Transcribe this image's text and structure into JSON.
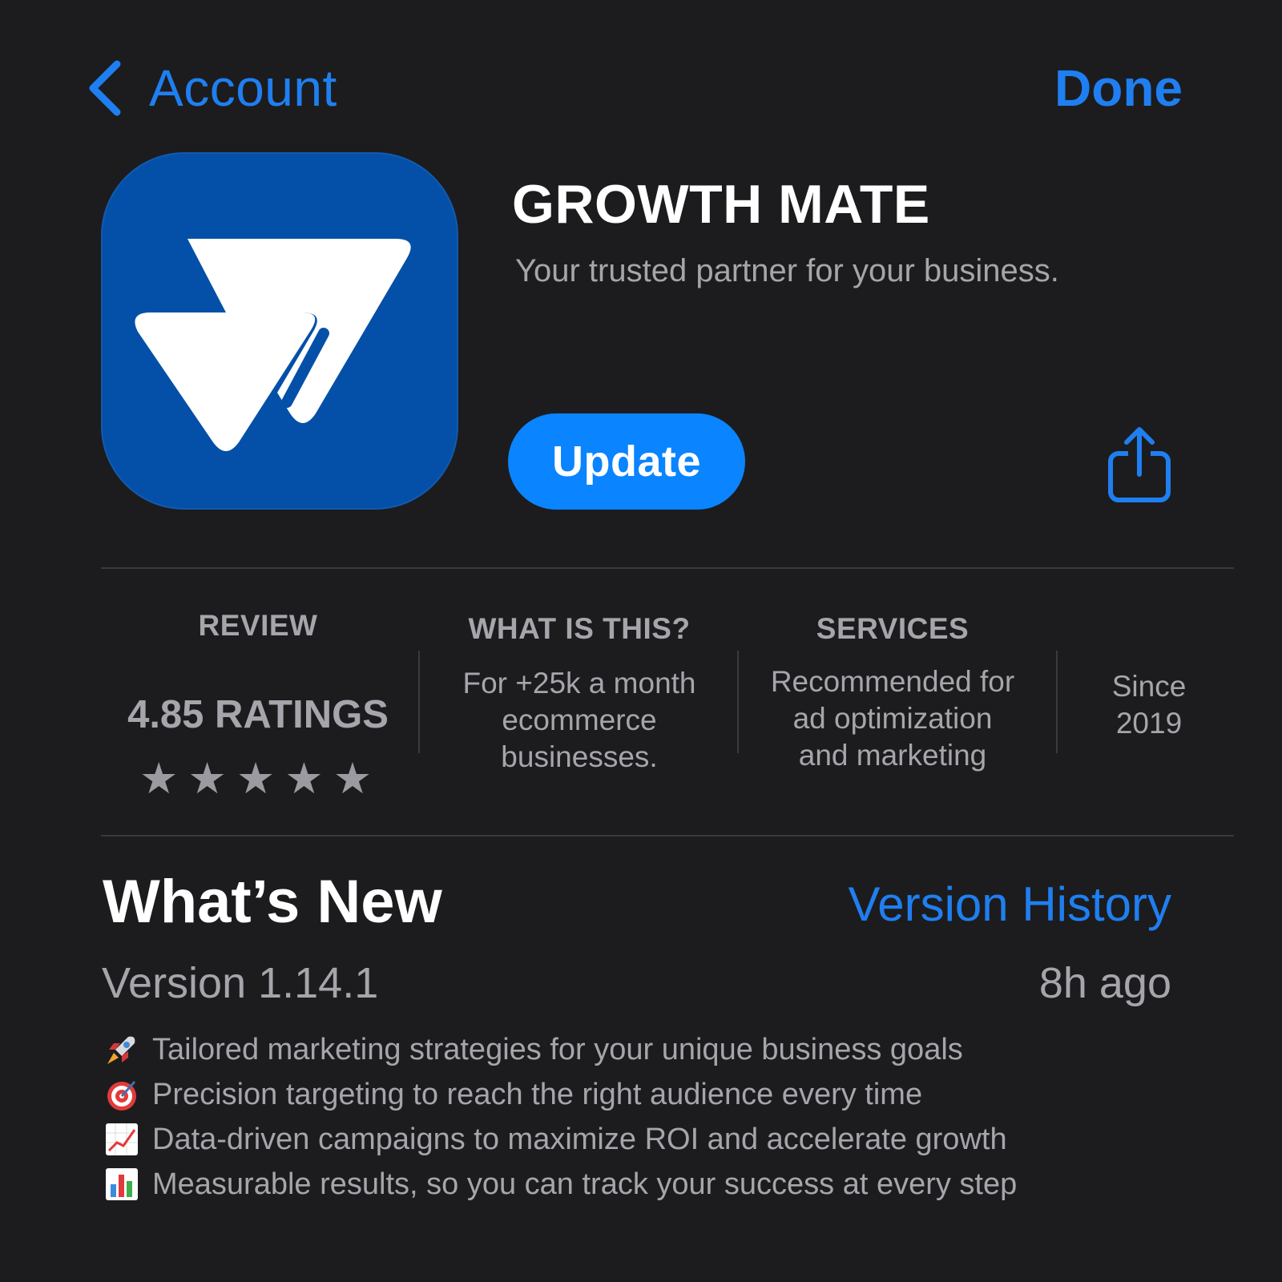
{
  "nav": {
    "back_label": "Account",
    "done_label": "Done"
  },
  "app": {
    "title": "GROWTH MATE",
    "subtitle": "Your trusted partner for your business.",
    "update_label": "Update"
  },
  "info": {
    "review": {
      "heading": "REVIEW",
      "value": "4.85 RATINGS",
      "stars": 5
    },
    "about": {
      "heading": "WHAT IS THIS?",
      "lines": [
        "For +25k a month",
        "ecommerce",
        "businesses."
      ]
    },
    "services": {
      "heading": "SERVICES",
      "lines": [
        "Recommended for",
        "ad optimization",
        "and marketing"
      ]
    },
    "since": {
      "lines": [
        "Since",
        "2019"
      ]
    }
  },
  "whats_new": {
    "title": "What’s New",
    "version_history_label": "Version History",
    "version": "Version 1.14.1",
    "time": "8h ago",
    "notes": [
      {
        "icon": "rocket-icon",
        "text": "Tailored marketing strategies for your unique business goals"
      },
      {
        "icon": "target-icon",
        "text": "Precision targeting to reach the right audience every time"
      },
      {
        "icon": "trend-chart-icon",
        "text": "Data-driven campaigns to maximize ROI and accelerate growth"
      },
      {
        "icon": "bar-chart-icon",
        "text": "Measurable results, so you can track your success at every step"
      }
    ]
  },
  "colors": {
    "background": "#1c1c1e",
    "accent": "#0a84ff",
    "link": "#1f7ff0",
    "icon_bg": "#0450a8",
    "secondary_text": "#a5a5ab",
    "divider": "#3a3a3c"
  }
}
